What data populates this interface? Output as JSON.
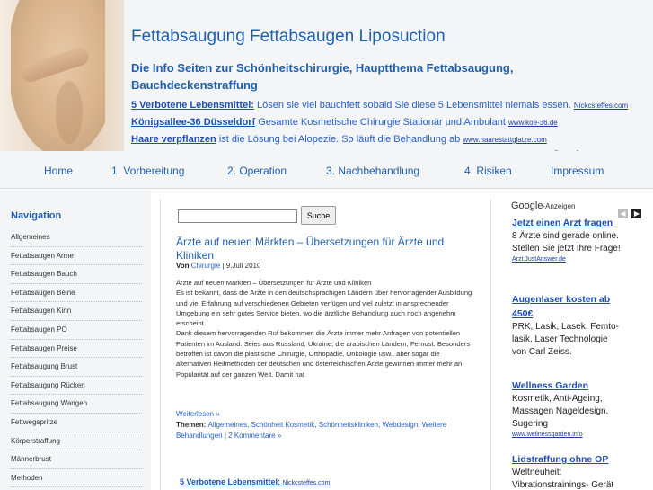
{
  "header": {
    "title": "Fettabsaugung Fettabsaugen Liposuction",
    "description": "Die Info Seiten zur Schönheitschirurgie, Hauptthema Fettabsaugung, Bauchdeckenstraffung",
    "ads": [
      {
        "title": "5 Verbotene Lebensmittel:",
        "text": " Lösen sie viel bauchfett sobald Sie diese 5 Lebensmittel niemals essen.",
        "url": "Nickcsteffes.com"
      },
      {
        "title": "Königsallee-36 Düsseldorf",
        "text": " Gesamte Kosmetische Chirurgie Stationär und Ambulant",
        "url": "www.koe-36.de"
      },
      {
        "title": "Haare verpflanzen",
        "text": " ist die Lösung bei Alopezie. So läuft die Behandlung ab",
        "url": "www.haarestattglatze.com"
      }
    ],
    "google_label": "Google",
    "google_suffix": "-Anzeigen",
    "arrow_prev": "◀",
    "arrow_next": "▶"
  },
  "nav": [
    "Home",
    "1. Vorbereitung",
    "2. Operation",
    "3. Nachbehandlung",
    "4. Risiken",
    "Impressum"
  ],
  "sidebar": {
    "heading": "Navigation",
    "items": [
      "Allgemeines",
      "Fettabsaugen Arme",
      "Fettabsaugen Bauch",
      "Fettabsaugen Beine",
      "Fettabsaugen Kinn",
      "Fettabsaugen PO",
      "Fettabsaugen Preise",
      "Fettabsaugung Brust",
      "Fettabsaugung Rücken",
      "Fettabsaugung Wangen",
      "Fettwegspritze",
      "Körperstraffung",
      "Männerbrust",
      "Methoden"
    ]
  },
  "search": {
    "button": "Suche",
    "value": ""
  },
  "post": {
    "title": "Ärzte auf neuen Märkten – Übersetzungen für Ärzte und Kliniken",
    "meta_prefix": "Von ",
    "author": "Chirurgie",
    "date": " | 9.Juli 2010",
    "body": [
      "Ärzte auf neuen Märkten – Übersetzungen für Ärzte und Kliniken",
      "Es ist bekannt, dass die Ärzte in den deutschsprachigen Ländern über hervorragender Ausbildung und viel Erfahrung auf verschiedenen Gebieten verfügen und viel zuletzt in ansprechender Umgebung ein sehr gutes Service bieten, wo die ärztliche Behandlung auch noch angenehm erscheint.",
      "Dank diesem hervorragenden Ruf bekommen die Ärzte immer mehr Anfragen von potentiellen Patienten im Ausland. Seies aus Russland, Ukraine, die arabischen Ländern, Fernost. Besonders betroffen ist davon die plastische Chirurgie, Orthopädie, Onkologie usw., aber sogar die alternativen Heilmethoden der deutschen und österreichischen Ärzte gewinnen immer mehr an Popularität auf der ganzen Welt. Damit hat"
    ],
    "read_more": "Weiterlesen »",
    "tags_label": "Themen: ",
    "tags": "Allgemeines, Schönheit Kosmetik, Schönheitskliniken, Webdesign, Weitere Behandlungen",
    "comments": "2 Kommentare »"
  },
  "bottom_ad": {
    "title": "5 Verbotene Lebensmittel:",
    "url": "Nickcsteffes.com"
  },
  "right_ads": [
    {
      "title": "Jetzt einen Arzt fragen",
      "text": "8 Ärzte sind gerade online. Stellen Sie jetzt Ihre Frage!",
      "url": "Arzt.JustAnswer.de"
    },
    {
      "title": "Augenlaser kosten ab 450€",
      "text": "PRK, Lasik, Lasek, Femto-lasik. Laser Technologie von Carl Zeiss.",
      "url": ""
    },
    {
      "title": "Wellness Garden",
      "text": "Kosmetik, Anti-Ageing, Massagen Nageldesign, Sugering",
      "url": "www.wellnessgarden.info"
    },
    {
      "title": "Lidstraffung ohne OP",
      "text": "Weltneuheit: Vibrationstrainings- Gerät",
      "url": ""
    }
  ]
}
